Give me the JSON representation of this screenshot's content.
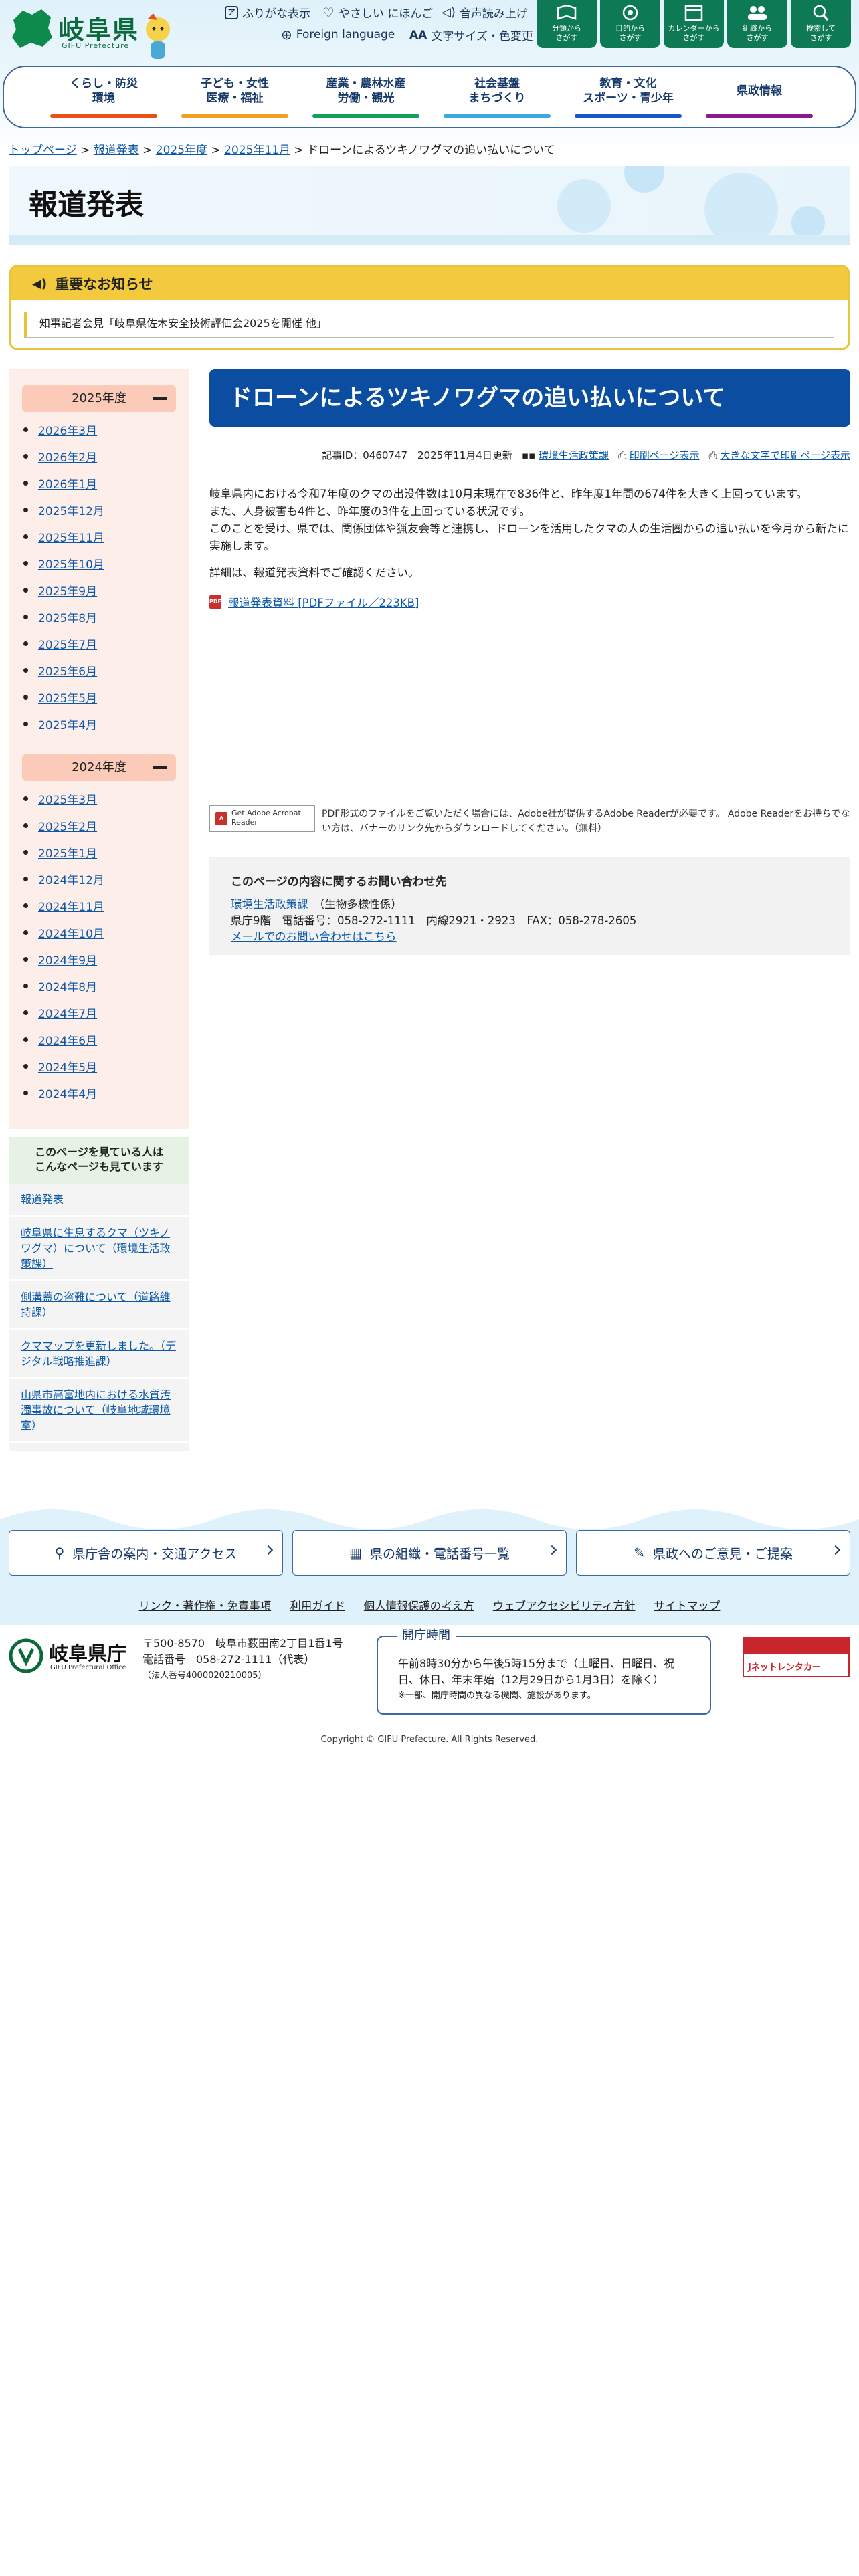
{
  "header": {
    "logo_text": "岐阜県",
    "logo_sub": "GIFU Prefecture",
    "utility": [
      {
        "label": "ふりがな表示",
        "icon": "furigana-icon"
      },
      {
        "label": "やさしい にほんご",
        "icon": "heart-icon"
      },
      {
        "label": "音声読み上げ",
        "icon": "speaker-icon"
      },
      {
        "label": "Foreign language",
        "icon": "globe-icon"
      },
      {
        "label": "文字サイズ・色変更",
        "icon": "text-size-icon"
      }
    ],
    "search_buttons": [
      {
        "line1": "分類から",
        "line2": "さがす",
        "icon": "book-icon"
      },
      {
        "line1": "目的から",
        "line2": "さがす",
        "icon": "target-icon"
      },
      {
        "line1": "カレンダーから",
        "line2": "さがす",
        "icon": "calendar-icon"
      },
      {
        "line1": "組織から",
        "line2": "さがす",
        "icon": "people-icon"
      },
      {
        "line1": "検索して",
        "line2": "さがす",
        "icon": "search-icon"
      }
    ]
  },
  "nav": [
    {
      "line1": "くらし・防災",
      "line2": "環境",
      "color": "#e8501a"
    },
    {
      "line1": "子ども・女性",
      "line2": "医療・福祉",
      "color": "#f0a020"
    },
    {
      "line1": "産業・農林水産",
      "line2": "労働・観光",
      "color": "#14a05a"
    },
    {
      "line1": "社会基盤",
      "line2": "まちづくり",
      "color": "#3ca8e0"
    },
    {
      "line1": "教育・文化",
      "line2": "スポーツ・青少年",
      "color": "#1a55c8"
    },
    {
      "line1": "県政情報",
      "line2": "",
      "color": "#8a1a8a"
    }
  ],
  "breadcrumb": [
    {
      "label": "トップページ",
      "link": true
    },
    {
      "label": "報道発表",
      "link": true
    },
    {
      "label": "2025年度",
      "link": true
    },
    {
      "label": "2025年11月",
      "link": true
    },
    {
      "label": "ドローンによるツキノワグマの追い払いについて",
      "link": false
    }
  ],
  "page_title": "報道発表",
  "notice": {
    "heading": "重要なお知らせ",
    "item": "知事記者会見「岐阜県佐木安全技術評価会2025を開催 他」"
  },
  "sidebar": {
    "year1": {
      "label": "2025年度",
      "months": [
        "2026年3月",
        "2026年2月",
        "2026年1月",
        "2025年12月",
        "2025年11月",
        "2025年10月",
        "2025年9月",
        "2025年8月",
        "2025年7月",
        "2025年6月",
        "2025年5月",
        "2025年4月"
      ]
    },
    "year2": {
      "label": "2024年度",
      "months": [
        "2025年3月",
        "2025年2月",
        "2025年1月",
        "2024年12月",
        "2024年11月",
        "2024年10月",
        "2024年9月",
        "2024年8月",
        "2024年7月",
        "2024年6月",
        "2024年5月",
        "2024年4月"
      ]
    },
    "related_heading": "このページを見ている人は\nこんなページも見ています",
    "related": [
      "報道発表",
      "岐阜県に生息するクマ（ツキノワグマ）について（環境生活政策課）",
      "側溝蓋の盗難について（道路維持課）",
      "クママップを更新しました。（デジタル戦略推進課）",
      "山県市高富地内における水質汚濁事故について（岐阜地域環境室）"
    ]
  },
  "article": {
    "title": "ドローンによるツキノワグマの追い払いについて",
    "meta_id": "記事ID：0460747　2025年11月4日更新",
    "meta_dept": "環境生活政策課",
    "meta_print": "印刷ページ表示",
    "meta_print_large": "大きな文字で印刷ページ表示",
    "p1": "岐阜県内における令和7年度のクマの出没件数は10月末現在で836件と、昨年度1年間の674件を大きく上回っています。",
    "p2": "また、人身被害も4件と、昨年度の3件を上回っている状況です。",
    "p3": "このことを受け、県では、関係団体や猟友会等と連携し、ドローンを活用したクマの人の生活圏からの追い払いを今月から新たに実施します。",
    "p4": "詳細は、報道発表資料でご確認ください。",
    "pdf_link": "報道発表資料 [PDFファイル／223KB]",
    "reader_badge": "Get Adobe Acrobat Reader",
    "reader_text": "PDF形式のファイルをご覧いただく場合には、Adobe社が提供するAdobe Readerが必要です。 Adobe Readerをお持ちでない方は、バナーのリンク先からダウンロードしてください。（無料）"
  },
  "contact": {
    "heading": "このページの内容に関するお問い合わせ先",
    "dept": "環境生活政策課",
    "dept_note": "（生物多様性係）",
    "tel": "県庁9階　電話番号：058-272-1111　内線2921・2923　FAX：058-278-2605",
    "mail": "メールでのお問い合わせはこちら"
  },
  "footer": {
    "buttons": [
      {
        "label": "県庁舎の案内・交通アクセス",
        "icon": "pin-icon"
      },
      {
        "label": "県の組織・電話番号一覧",
        "icon": "building-icon"
      },
      {
        "label": "県政へのご意見・ご提案",
        "icon": "chat-icon"
      }
    ],
    "links": [
      "リンク・著作権・免責事項",
      "利用ガイド",
      "個人情報保護の考え方",
      "ウェブアクセシビリティ方針",
      "サイトマップ"
    ],
    "org_name": "岐阜県庁",
    "org_sub": "GIFU Prefectural Office",
    "addr1": "〒500-8570　岐阜市薮田南2丁目1番1号",
    "addr2": "電話番号　058-272-1111（代表）",
    "addr3": "（法人番号4000020210005）",
    "hours_title": "開庁時間",
    "hours1": "午前8時30分から午後5時15分まで（土曜日、日曜日、祝",
    "hours2": "日、休日、年末年始（12月29日から1月3日）を除く）",
    "hours_note": "※一部、開庁時間の異なる機関、施設があります。",
    "banner": "Jネットレンタカー",
    "copyright": "Copyright © GIFU Prefecture. All Rights Reserved."
  }
}
